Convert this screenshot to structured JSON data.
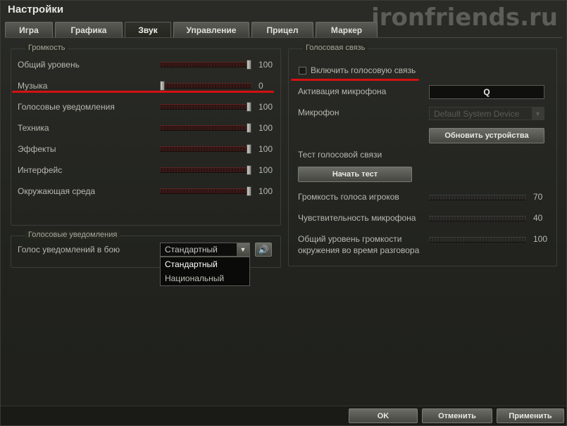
{
  "window": {
    "title": "Настройки",
    "watermark": "ironfriends.ru"
  },
  "tabs": [
    {
      "label": "Игра",
      "active": false
    },
    {
      "label": "Графика",
      "active": false
    },
    {
      "label": "Звук",
      "active": true
    },
    {
      "label": "Управление",
      "active": false
    },
    {
      "label": "Прицел",
      "active": false
    },
    {
      "label": "Маркер",
      "active": false
    }
  ],
  "volume": {
    "group_title": "Громкость",
    "rows": [
      {
        "label": "Общий уровень",
        "value": "100",
        "level": 100
      },
      {
        "label": "Музыка",
        "value": "0",
        "level": 0
      },
      {
        "label": "Голосовые уведомления",
        "value": "100",
        "level": 100
      },
      {
        "label": "Техника",
        "value": "100",
        "level": 100
      },
      {
        "label": "Эффекты",
        "value": "100",
        "level": 100
      },
      {
        "label": "Интерфейс",
        "value": "100",
        "level": 100
      },
      {
        "label": "Окружающая среда",
        "value": "100",
        "level": 100
      }
    ]
  },
  "voice_notifications": {
    "group_title": "Голосовые уведомления",
    "label": "Голос уведомлений в бою",
    "selected": "Стандартный",
    "options": [
      "Стандартный",
      "Национальный"
    ]
  },
  "voice_chat": {
    "group_title": "Голосовая связь",
    "enable_label": "Включить голосовую связь",
    "mic_activation_label": "Активация микрофона",
    "mic_activation_key": "Q",
    "microphone_label": "Микрофон",
    "microphone_value": "Default System Device",
    "refresh_button": "Обновить устройства",
    "test_label": "Тест голосовой связи",
    "test_button": "Начать тест",
    "sliders": [
      {
        "label": "Громкость голоса игроков",
        "value": "70",
        "level": 70
      },
      {
        "label": "Чувствительность микрофона",
        "value": "40",
        "level": 40
      },
      {
        "label_line1": "Общий уровень громкости",
        "label_line2": "окружения во время разговора",
        "value": "100",
        "level": 100
      }
    ]
  },
  "footer": {
    "ok": "OK",
    "cancel": "Отменить",
    "apply": "Применить"
  },
  "colors": {
    "highlight": "#d41111"
  }
}
